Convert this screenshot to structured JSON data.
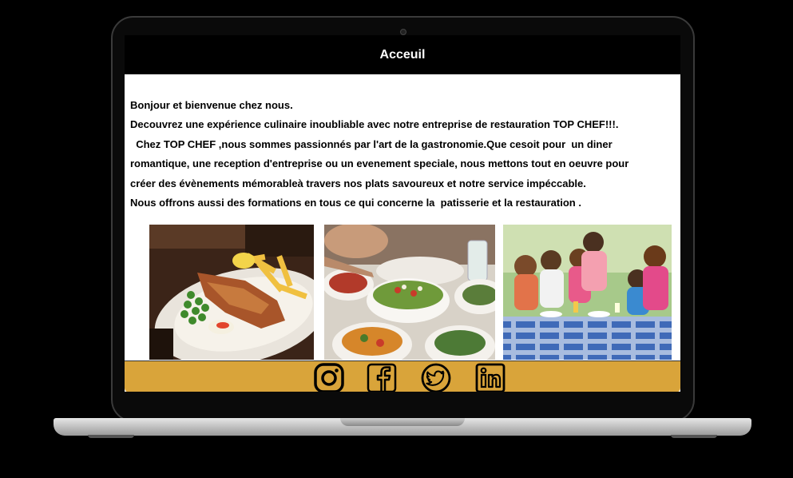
{
  "header": {
    "title": "Acceuil"
  },
  "intro": {
    "lines": [
      "Bonjour et bienvenue chez nous.",
      "Decouvrez une expérience culinaire inoubliable avec notre entreprise de restauration TOP CHEF!!!.",
      "  Chez TOP CHEF ,nous sommes passionnés par l'art de la gastronomie.Que cesoit pour  un diner",
      "romantique, une reception d'entreprise ou un evenement speciale, nous mettons tout en oeuvre pour",
      "créer des évènements mémorableà travers nos plats savoureux et notre service impéccable.",
      "Nous offrons aussi des formations en tous ce qui concerne la  patisserie et la restauration ."
    ]
  },
  "gallery": {
    "images": [
      "fish-and-chips-photo",
      "salad-table-photo",
      "family-dining-photo"
    ]
  },
  "footer": {
    "accent": "#d9a43a",
    "social": [
      "instagram-icon",
      "facebook-icon",
      "twitter-icon",
      "linkedin-icon"
    ]
  }
}
